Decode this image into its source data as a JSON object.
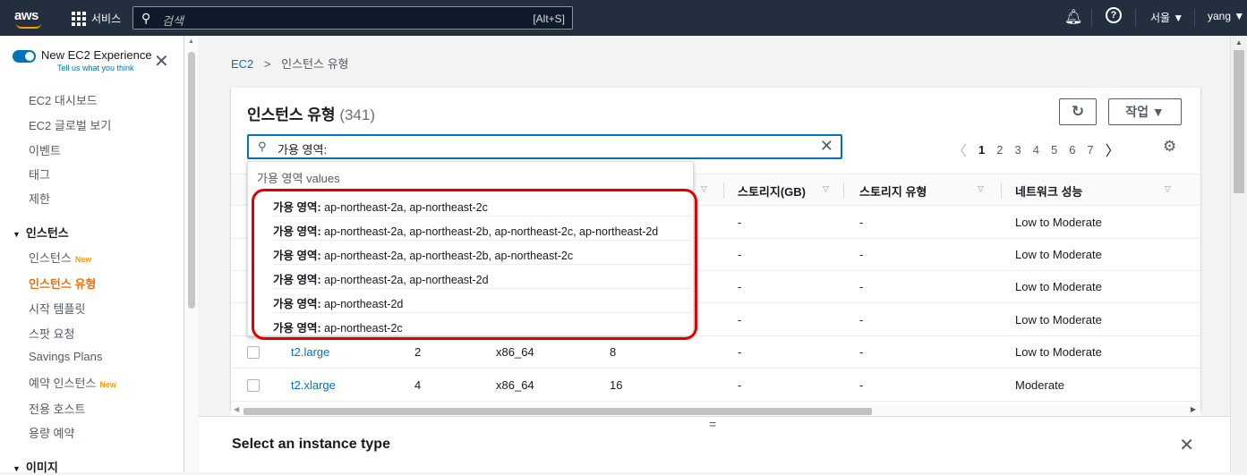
{
  "topnav": {
    "logo": "aws",
    "services_label": "서비스",
    "search_placeholder": "검색",
    "search_shortcut": "[Alt+S]",
    "region": "서울 ▼",
    "user": "yang ▼"
  },
  "sidebar": {
    "experience_title": "New EC2 Experience",
    "experience_link": "Tell us what you think",
    "items": [
      {
        "label": "EC2 대시보드"
      },
      {
        "label": "EC2 글로벌 보기"
      },
      {
        "label": "이벤트"
      },
      {
        "label": "태그"
      },
      {
        "label": "제한"
      }
    ],
    "section_instances": "인스턴스",
    "instance_items": [
      {
        "label": "인스턴스",
        "badge": "New"
      },
      {
        "label": "인스턴스 유형",
        "badge": ""
      },
      {
        "label": "시작 템플릿",
        "badge": ""
      },
      {
        "label": "스팟 요청",
        "badge": ""
      },
      {
        "label": "Savings Plans",
        "badge": ""
      },
      {
        "label": "예약 인스턴스",
        "badge": "New"
      },
      {
        "label": "전용 호스트",
        "badge": ""
      },
      {
        "label": "용량 예약",
        "badge": ""
      }
    ],
    "section_images": "이미지"
  },
  "breadcrumb": {
    "root": "EC2",
    "separator": ">",
    "current": "인스턴스 유형"
  },
  "panel": {
    "title": "인스턴스 유형",
    "count": "(341)",
    "actions_label": "작업 ▼",
    "filter_value": "가용 영역: ",
    "pages": [
      "1",
      "2",
      "3",
      "4",
      "5",
      "6",
      "7"
    ]
  },
  "table": {
    "headers": [
      "스토리지(GB)",
      "스토리지 유형",
      "네트워크 성능"
    ],
    "rows": [
      {
        "name": "",
        "vcpu": "",
        "arch": "",
        "mem": "",
        "storage": "-",
        "stype": "-",
        "net": "Low to Moderate"
      },
      {
        "name": "",
        "vcpu": "",
        "arch": "",
        "mem": "",
        "storage": "-",
        "stype": "-",
        "net": "Low to Moderate"
      },
      {
        "name": "",
        "vcpu": "",
        "arch": "",
        "mem": "",
        "storage": "-",
        "stype": "-",
        "net": "Low to Moderate"
      },
      {
        "name": "",
        "vcpu": "",
        "arch": "",
        "mem": "",
        "storage": "-",
        "stype": "-",
        "net": "Low to Moderate"
      },
      {
        "name": "t2.large",
        "vcpu": "2",
        "arch": "x86_64",
        "mem": "8",
        "storage": "-",
        "stype": "-",
        "net": "Low to Moderate"
      },
      {
        "name": "t2.xlarge",
        "vcpu": "4",
        "arch": "x86_64",
        "mem": "16",
        "storage": "-",
        "stype": "-",
        "net": "Moderate"
      }
    ]
  },
  "dropdown": {
    "header": "가용 영역 values",
    "key_label": "가용 영역:",
    "options": [
      {
        "value": "ap-northeast-2a, ap-northeast-2c"
      },
      {
        "value": "ap-northeast-2a, ap-northeast-2b, ap-northeast-2c, ap-northeast-2d"
      },
      {
        "value": "ap-northeast-2a, ap-northeast-2b, ap-northeast-2c"
      },
      {
        "value": "ap-northeast-2a, ap-northeast-2d"
      },
      {
        "value": "ap-northeast-2d"
      },
      {
        "value": "ap-northeast-2c"
      }
    ]
  },
  "bottom_panel": {
    "grip": "=",
    "title": "Select an instance type"
  },
  "colors": {
    "topnav_bg": "#232f3e",
    "accent": "#0073bb",
    "active_orange": "#ec7211",
    "highlight": "#e00000"
  }
}
